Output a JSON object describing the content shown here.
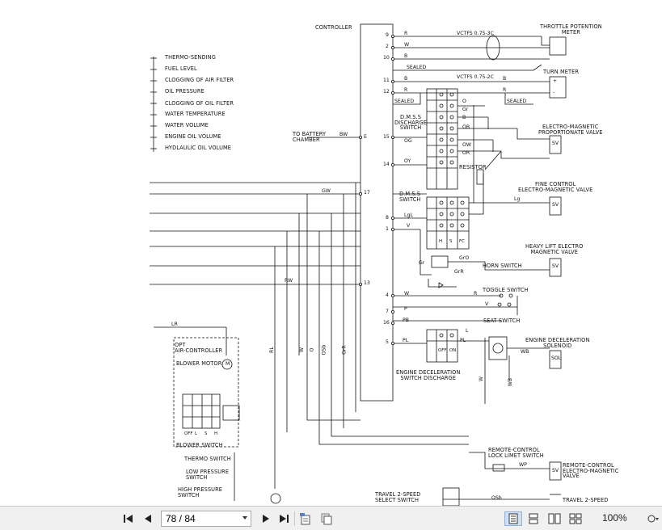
{
  "diagram": {
    "controller": "CONTROLLER",
    "throttle": "THROTTLE POTENTION\nMETER",
    "turn_meter": "TURN METER",
    "sensors": [
      "THERMO-SENDING",
      "FUEL LEVEL",
      "CLOGGING OF AIR FILTER",
      "OIL PRESSURE",
      "CLOGGING OF OIL FILTER",
      "WATER TEMPERATURE",
      "WATER VOLUME",
      "ENGINE OIL VOLUME",
      "HYDLAULIC OIL VOLUME"
    ],
    "battery": "TO BATTERY\nCHAMBER",
    "dmss_discharge": "D.M.S.S\nDISCHARGE\nSWITCH",
    "resistor": "RESISTOR",
    "em_proportionate": "ELECTRO-MAGNETIC\nPROPORTIONATE VALVE",
    "fine_control": "FINE CONTROL\nELECTRO-MAGNETIC VALVE",
    "dmss_switch": "D.M.S.S\nSWITCH",
    "heavy_lift": "HEAVY LIFT ELECTRO\nMAGNETIC VALVE",
    "horn_switch": "HORN SWITCH",
    "toggle_switch": "TOGGLE SWITCH",
    "seat_switch": "SEAT SWITCH",
    "engine_decel_solenoid": "ENGINE DECELERATION\nSOLENOID",
    "engine_decel_switch": "ENGINE DECELERATION\nSWITCH DISCHARGE",
    "opt": "OPT\nAIR-CONTROLLER",
    "blower_motor": "BLOWER MOTOR",
    "blower_switch": "BLOWER SWITCH",
    "thermo_switch": "THERMO SWITCH",
    "low_pressure": "LOW PRESSURE\nSWITCH",
    "high_pressure": "HIGH PRESSURE\nSWITCH",
    "remote_lock": "REMOTE-CONTROL\nLOCK LIMET SWITCH",
    "remote_em": "REMOTE-CONTROL\nELECTRO-MAGNETIC\nVALVE",
    "travel_select": "TRAVEL 2-SPEED\nSELECT SWITCH",
    "travel_2speed": "TRAVEL 2-SPEED",
    "cable_1": "VCTFS 0.75-3C",
    "cable_2": "VCTFS 0.75-2C",
    "sealed": "SEALED",
    "sv": "SV",
    "sol": "SOL",
    "m": "M",
    "wires": {
      "W": "W",
      "B": "B",
      "R": "R",
      "E": "E",
      "BW": "BW",
      "GW": "GW",
      "RW": "RW",
      "LR": "LR",
      "RL": "RL",
      "O": "O",
      "OSb": "OSb",
      "GrR": "GrR",
      "Gr": "Gr",
      "OB": "OB",
      "OW": "OW",
      "OR": "OR",
      "OG": "OG",
      "OY": "OY",
      "Lg": "Lg",
      "LgL": "LgL",
      "V": "V",
      "GrO": "GrO",
      "P": "P",
      "PB": "PB",
      "PL": "PL",
      "L": "L",
      "WB": "WB",
      "WP": "WP",
      "OSb2": "OSb"
    },
    "pins": [
      "9",
      "2",
      "10",
      "11",
      "12",
      "15",
      "14",
      "17",
      "8",
      "1",
      "13",
      "4",
      "7",
      "16",
      "5"
    ],
    "switch_cols": [
      "H",
      "S",
      "FC"
    ],
    "decel_cols": [
      "ON",
      "OFF"
    ],
    "blower_cols": [
      "OFF",
      "L",
      "S",
      "H"
    ],
    "term_plus": "+",
    "term_minus": "-"
  },
  "toolbar": {
    "first_page": "first-page",
    "prev_page": "prev-page",
    "page_value": "78 / 84",
    "next_page": "next-page",
    "last_page": "last-page",
    "zoom": "100%"
  }
}
